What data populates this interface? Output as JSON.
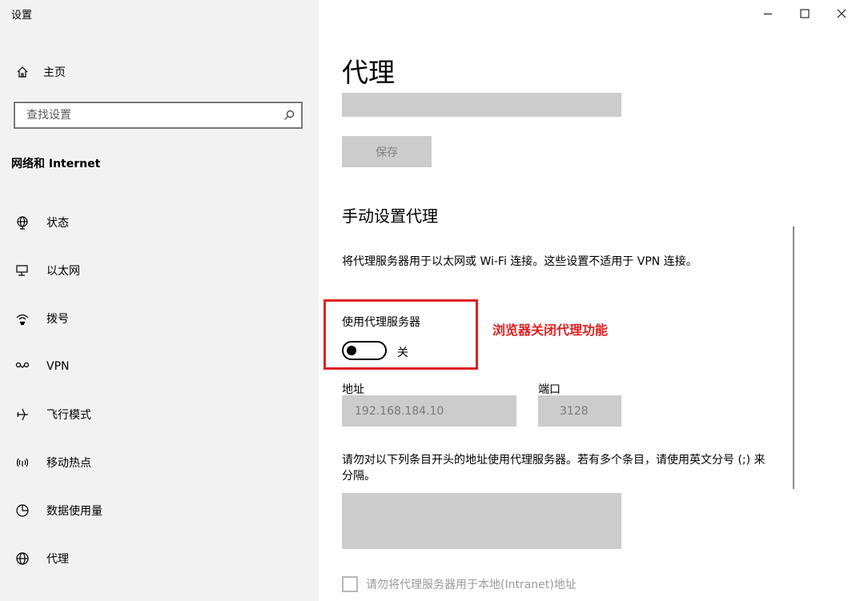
{
  "app": {
    "title": "设置"
  },
  "sidebar": {
    "home": {
      "label": "主页",
      "icon": "home-icon"
    },
    "search": {
      "placeholder": "查找设置",
      "icon": "search-icon"
    },
    "section_title": "网络和 Internet",
    "items": [
      {
        "label": "状态",
        "icon": "globe-status-icon"
      },
      {
        "label": "以太网",
        "icon": "ethernet-icon"
      },
      {
        "label": "拨号",
        "icon": "dialup-icon"
      },
      {
        "label": "VPN",
        "icon": "vpn-icon"
      },
      {
        "label": "飞行模式",
        "icon": "airplane-icon"
      },
      {
        "label": "移动热点",
        "icon": "hotspot-icon"
      },
      {
        "label": "数据使用量",
        "icon": "data-usage-icon"
      },
      {
        "label": "代理",
        "icon": "globe-icon"
      }
    ]
  },
  "window_controls": {
    "minimize": "—",
    "maximize": "☐",
    "close": "✕"
  },
  "main": {
    "title": "代理",
    "save_label": "保存",
    "manual_heading": "手动设置代理",
    "manual_desc": "将代理服务器用于以太网或 Wi-Fi 连接。这些设置不适用于 VPN 连接。",
    "use_proxy_label": "使用代理服务器",
    "use_proxy_state": "关",
    "annotation": "浏览器关闭代理功能",
    "address_label": "地址",
    "address_value": "192.168.184.10",
    "port_label": "端口",
    "port_value": "3128",
    "exceptions_desc": "请勿对以下列条目开头的地址使用代理服务器。若有多个条目，请使用英文分号 (;) 来分隔。",
    "local_check_label": "请勿将代理服务器用于本地(Intranet)地址"
  },
  "colors": {
    "sidebar_bg": "#f2f2f2",
    "disabled_gray": "#cccccc",
    "annotation_red": "#e02020"
  }
}
